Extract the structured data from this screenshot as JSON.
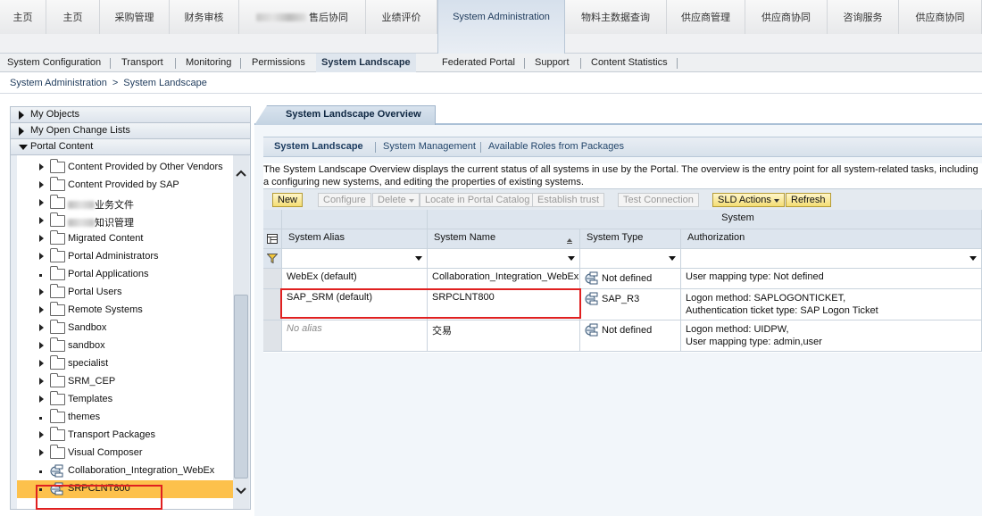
{
  "top_tabs": [
    {
      "label": "主页"
    },
    {
      "label": "主页"
    },
    {
      "label": "采购管理"
    },
    {
      "label": "财务审核"
    },
    {
      "label": "售后协同",
      "partially_obscured": true
    },
    {
      "label": "业绩评价"
    },
    {
      "label": "System Administration",
      "active": true
    },
    {
      "label": "物料主数据查询"
    },
    {
      "label": "供应商管理"
    },
    {
      "label": "供应商协同"
    },
    {
      "label": "咨询服务"
    },
    {
      "label": "供应商协同"
    }
  ],
  "sub_nav": [
    {
      "label": "System Configuration"
    },
    {
      "label": "Transport"
    },
    {
      "label": "Monitoring"
    },
    {
      "label": "Permissions"
    },
    {
      "label": "System Landscape",
      "active": true
    },
    {
      "label": "Federated Portal"
    },
    {
      "label": "Support"
    },
    {
      "label": "Content Statistics"
    }
  ],
  "breadcrumb": {
    "first": "System Administration",
    "separator": ">",
    "current": "System Landscape"
  },
  "left_panel": {
    "my_objects": "My Objects",
    "change_lists": "My Open Change Lists",
    "portal_content": "Portal Content",
    "tree": [
      {
        "label": "Content Provided by Other Vendors",
        "type": "folder",
        "expandable": true
      },
      {
        "label": "Content Provided by SAP",
        "type": "folder",
        "expandable": true
      },
      {
        "label": "业务文件",
        "type": "folder",
        "expandable": true,
        "partially_obscured": true
      },
      {
        "label": "知识管理",
        "type": "folder",
        "expandable": true,
        "partially_obscured": true
      },
      {
        "label": "Migrated Content",
        "type": "folder",
        "expandable": true
      },
      {
        "label": "Portal Administrators",
        "type": "folder",
        "expandable": true
      },
      {
        "label": "Portal Applications",
        "type": "folder",
        "expandable": false
      },
      {
        "label": "Portal Users",
        "type": "folder",
        "expandable": true
      },
      {
        "label": "Remote Systems",
        "type": "folder",
        "expandable": true
      },
      {
        "label": "Sandbox",
        "type": "folder",
        "expandable": true
      },
      {
        "label": "sandbox",
        "type": "folder",
        "expandable": true
      },
      {
        "label": "specialist",
        "type": "folder",
        "expandable": true
      },
      {
        "label": "SRM_CEP",
        "type": "folder",
        "expandable": true
      },
      {
        "label": "Templates",
        "type": "folder",
        "expandable": true
      },
      {
        "label": "themes",
        "type": "folder",
        "expandable": false
      },
      {
        "label": "Transport Packages",
        "type": "folder",
        "expandable": true
      },
      {
        "label": "Visual Composer",
        "type": "folder",
        "expandable": true
      },
      {
        "label": "Collaboration_Integration_WebEx",
        "type": "system",
        "expandable": false
      },
      {
        "label": "SRPCLNT800",
        "type": "system",
        "expandable": false,
        "selected": true
      }
    ]
  },
  "content": {
    "overview_tab": "System Landscape Overview",
    "inner_tabs": [
      "System Landscape",
      "System Management",
      "Available Roles from Packages"
    ],
    "description": "The System Landscape Overview displays the current status of all systems in use by the Portal. The overview is the entry point for all system-related tasks, including a configuring new systems, and editing the properties of existing systems.",
    "toolbar": [
      {
        "label": "New",
        "enabled": true
      },
      {
        "label": "Configure",
        "enabled": false
      },
      {
        "label": "Delete",
        "enabled": false,
        "dropdown": true
      },
      {
        "label": "Locate in Portal Catalog",
        "enabled": false
      },
      {
        "label": "Establish trust",
        "enabled": false
      },
      {
        "label": "Test Connection",
        "enabled": false
      },
      {
        "label": "SLD Actions",
        "enabled": true,
        "dropdown": true
      },
      {
        "label": "Refresh",
        "enabled": true
      }
    ],
    "table": {
      "group_header": "System",
      "columns": [
        "System Alias",
        "System Name",
        "System Type",
        "Authorization"
      ],
      "sorted_column": "System Name",
      "rows": [
        {
          "alias": "WebEx (default)",
          "name": "Collaboration_Integration_WebEx",
          "type": "Not defined",
          "auth1": "User mapping type: Not defined",
          "auth2": ""
        },
        {
          "alias": "SAP_SRM (default)",
          "name": "SRPCLNT800",
          "type": "SAP_R3",
          "auth1": "Logon method: SAPLOGONTICKET,",
          "auth2": "Authentication ticket type: SAP Logon Ticket"
        },
        {
          "alias": "No alias",
          "name": "交易",
          "type": "Not defined",
          "auth1": "Logon method: UIDPW,",
          "auth2": "User mapping type: admin,user"
        }
      ]
    }
  },
  "colors": {
    "selected_tree_item": "#fdc14c",
    "highlight_box": "#e02020",
    "enabled_button": "#f4dd74"
  }
}
